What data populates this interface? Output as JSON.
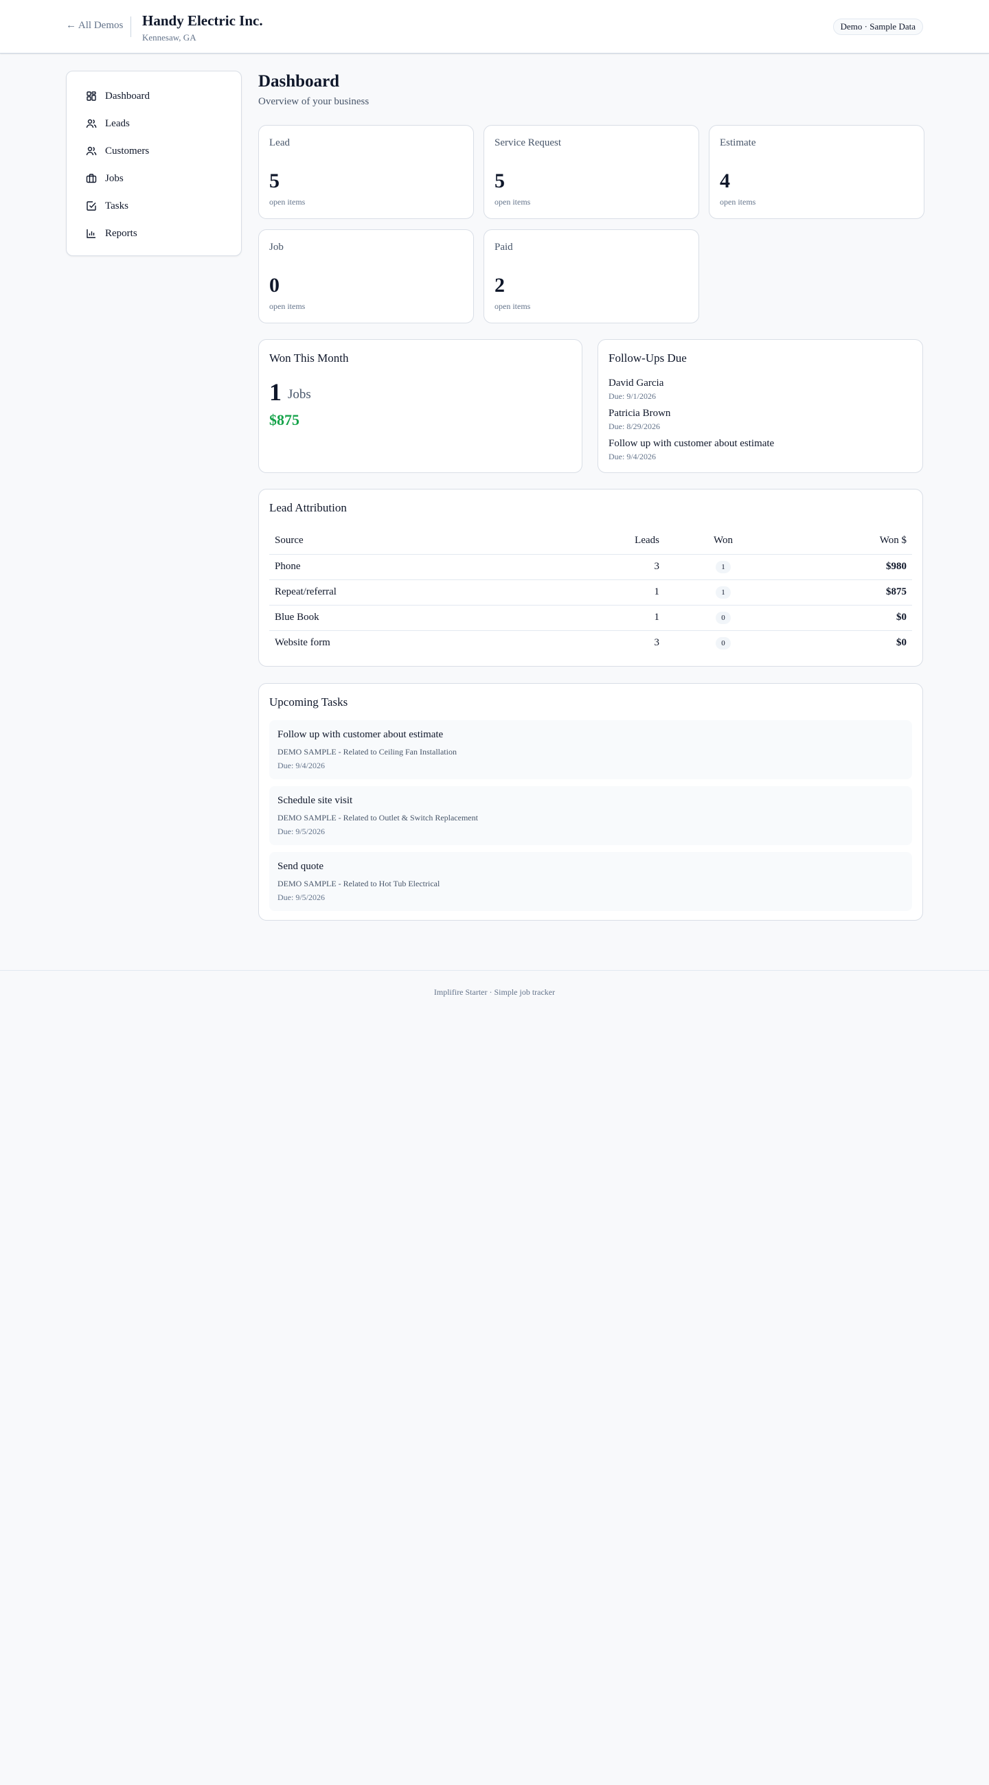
{
  "header": {
    "back_label": "← All Demos",
    "company_name": "Handy Electric Inc.",
    "company_location": "Kennesaw, GA",
    "badge": "Demo · Sample Data"
  },
  "sidebar": {
    "items": [
      {
        "label": "Dashboard",
        "icon": "dashboard-icon"
      },
      {
        "label": "Leads",
        "icon": "users-icon"
      },
      {
        "label": "Customers",
        "icon": "users-icon"
      },
      {
        "label": "Jobs",
        "icon": "briefcase-icon"
      },
      {
        "label": "Tasks",
        "icon": "checkbox-icon"
      },
      {
        "label": "Reports",
        "icon": "bar-chart-icon"
      }
    ]
  },
  "page": {
    "title": "Dashboard",
    "subtitle": "Overview of your business"
  },
  "stats": [
    {
      "label": "Lead",
      "value": "5",
      "caption": "open items"
    },
    {
      "label": "Service Request",
      "value": "5",
      "caption": "open items"
    },
    {
      "label": "Estimate",
      "value": "4",
      "caption": "open items"
    },
    {
      "label": "Job",
      "value": "0",
      "caption": "open items"
    },
    {
      "label": "Paid",
      "value": "2",
      "caption": "open items"
    }
  ],
  "won_this_month": {
    "title": "Won This Month",
    "count": "1",
    "unit": "Jobs",
    "amount": "$875"
  },
  "follow_ups": {
    "title": "Follow-Ups Due",
    "items": [
      {
        "name": "David Garcia",
        "due": "Due: 9/1/2026"
      },
      {
        "name": "Patricia Brown",
        "due": "Due: 8/29/2026"
      },
      {
        "name": "Follow up with customer about estimate",
        "due": "Due: 9/4/2026"
      }
    ]
  },
  "lead_attribution": {
    "title": "Lead Attribution",
    "headers": {
      "source": "Source",
      "leads": "Leads",
      "won": "Won",
      "won_usd": "Won $"
    },
    "rows": [
      {
        "source": "Phone",
        "leads": "3",
        "won": "1",
        "won_usd": "$980"
      },
      {
        "source": "Repeat/referral",
        "leads": "1",
        "won": "1",
        "won_usd": "$875"
      },
      {
        "source": "Blue Book",
        "leads": "1",
        "won": "0",
        "won_usd": "$0"
      },
      {
        "source": "Website form",
        "leads": "3",
        "won": "0",
        "won_usd": "$0"
      }
    ]
  },
  "upcoming_tasks": {
    "title": "Upcoming Tasks",
    "items": [
      {
        "title": "Follow up with customer about estimate",
        "related": "DEMO SAMPLE - Related to Ceiling Fan Installation",
        "due": "Due: 9/4/2026"
      },
      {
        "title": "Schedule site visit",
        "related": "DEMO SAMPLE - Related to Outlet & Switch Replacement",
        "due": "Due: 9/5/2026"
      },
      {
        "title": "Send quote",
        "related": "DEMO SAMPLE - Related to Hot Tub Electrical",
        "due": "Due: 9/5/2026"
      }
    ]
  },
  "footer": {
    "text": "Implifire Starter · Simple job tracker"
  },
  "colors": {
    "accent_green": "#16a34a",
    "muted_text": "#64748b",
    "border": "#d9dee6"
  }
}
